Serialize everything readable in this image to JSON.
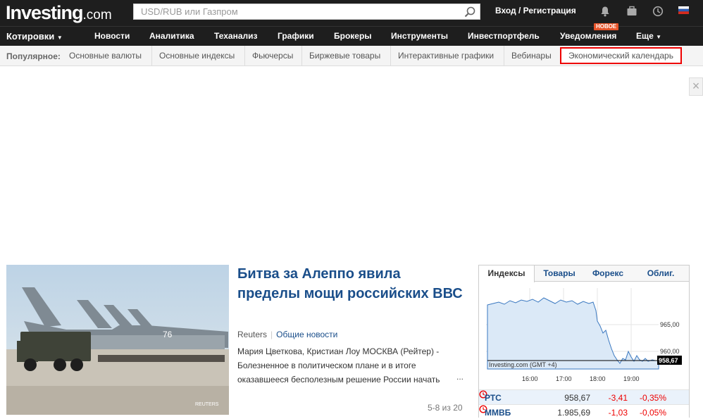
{
  "header": {
    "logo_main": "Investing",
    "logo_suffix": ".com",
    "search_placeholder": "USD/RUB или Газпром",
    "login_label": "Вход / Регистрация",
    "icons": [
      "bell-icon",
      "briefcase-icon",
      "clock-icon",
      "flag-ru-icon"
    ]
  },
  "nav": {
    "items": [
      "Котировки",
      "Новости",
      "Аналитика",
      "Теханализ",
      "Графики",
      "Брокеры",
      "Инструменты",
      "Инвестпортфель",
      "Уведомления",
      "Еще"
    ],
    "new_badge": "НОВОЕ"
  },
  "popular": {
    "label": "Популярное:",
    "links": [
      "Основные валюты",
      "Основные индексы",
      "Фьючерсы",
      "Биржевые товары",
      "Интерактивные графики",
      "Вебинары",
      "Экономический календарь"
    ]
  },
  "ad": {
    "close_symbol": "×"
  },
  "news": {
    "image_watermark": "REUTERS",
    "plane_number": "76",
    "headline": "Битва за Алеппо явила пределы мощи российских ВВС",
    "source": "Reuters",
    "category": "Общие новости",
    "summary": "Мария Цветкова, Кристиан Лоу МОСКВА (Рейтер) - Болезненное в политическом плане и в итоге оказавшееся бесполезным решение России начать",
    "more": "...",
    "pager": "5-8 из 20"
  },
  "widget": {
    "tabs": [
      "Индексы",
      "Товары",
      "Форекс",
      "Облиг."
    ],
    "chart_data": {
      "type": "area",
      "x_ticks": [
        "16:00",
        "17:00",
        "18:00",
        "19:00"
      ],
      "y_ticks": [
        "965,00",
        "960,00"
      ],
      "current_value": "958,67",
      "credit": "Investing.com (GMT +4)"
    },
    "rows": [
      {
        "name": "РТС",
        "value": "958,67",
        "change": "-3,41",
        "percent": "-0,35%"
      },
      {
        "name": "ММВБ",
        "value": "1.985,69",
        "change": "-1,03",
        "percent": "-0,05%"
      }
    ]
  }
}
